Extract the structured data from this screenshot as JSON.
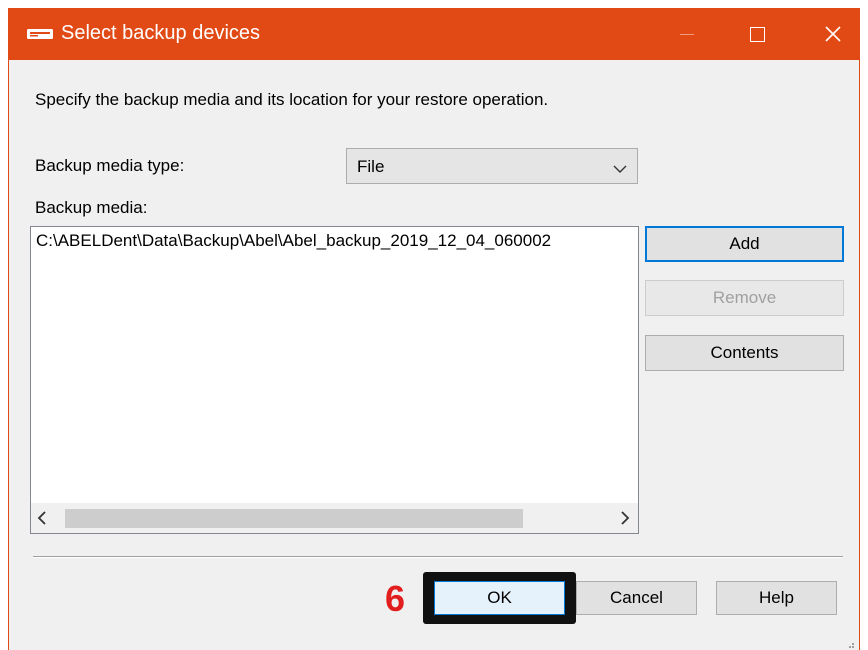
{
  "window": {
    "title": "Select backup devices",
    "title_icon": "tape-drive-icon",
    "accent_color": "#e24a15"
  },
  "instruction": "Specify the backup media and its location for your restore operation.",
  "media_type": {
    "label": "Backup media type:",
    "selected": "File"
  },
  "media_list": {
    "label": "Backup media:",
    "items": [
      "C:\\ABELDent\\Data\\Backup\\Abel\\Abel_backup_2019_12_04_060002"
    ]
  },
  "side_buttons": {
    "add": "Add",
    "remove": "Remove",
    "contents": "Contents"
  },
  "footer": {
    "step_marker": "6",
    "step_marker_color": "#e21d1d",
    "ok": "OK",
    "cancel": "Cancel",
    "help": "Help"
  }
}
